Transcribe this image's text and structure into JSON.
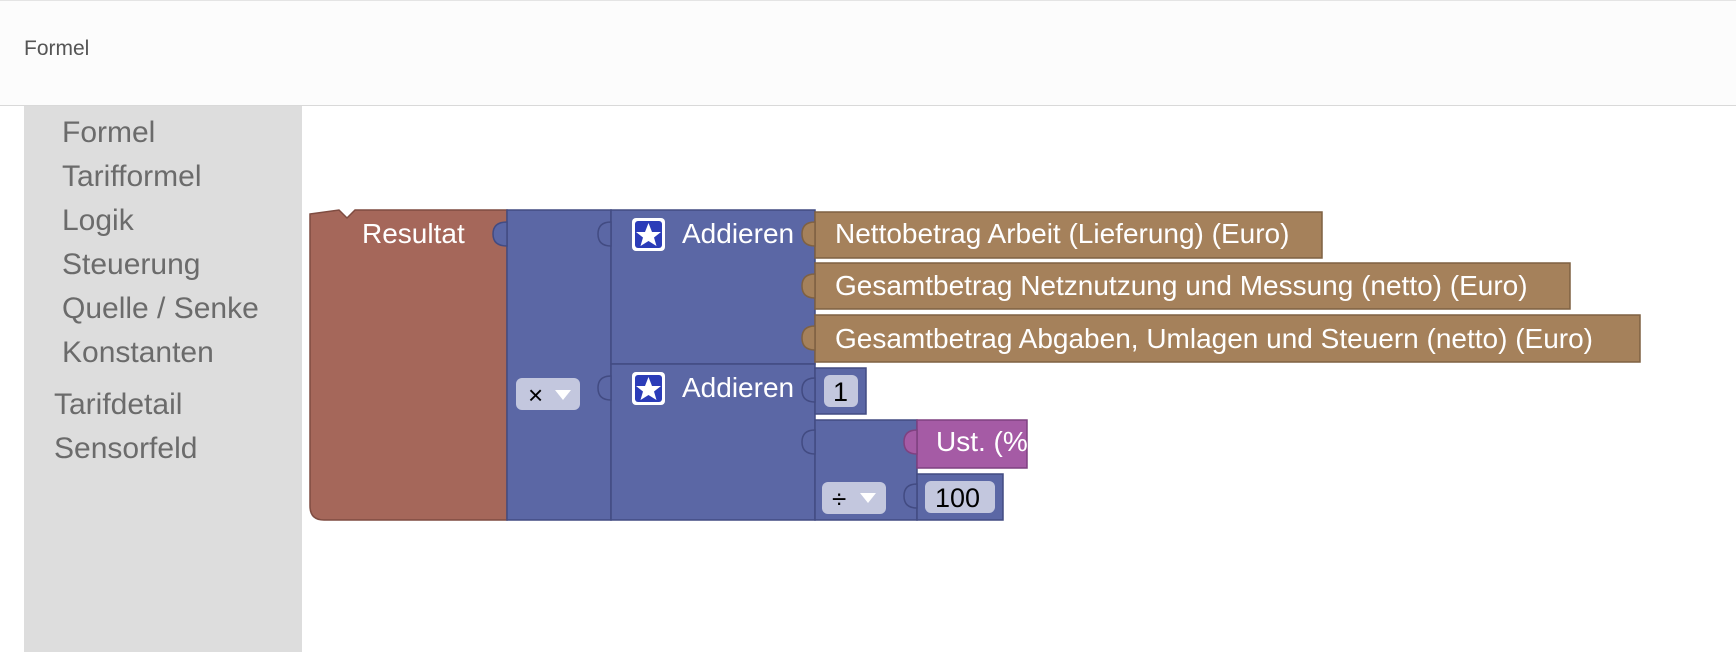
{
  "header": {
    "title": "Formel"
  },
  "toolbox": {
    "categories": [
      {
        "label": "Formel"
      },
      {
        "label": "Tarifformel"
      },
      {
        "label": "Logik"
      },
      {
        "label": "Steuerung"
      },
      {
        "label": "Quelle / Senke"
      },
      {
        "label": "Konstanten"
      }
    ],
    "top_categories": [
      {
        "label": "Tarifdetail"
      },
      {
        "label": "Sensorfeld"
      }
    ]
  },
  "blocks": {
    "result": {
      "label": "Resultat",
      "color": "#a5675a"
    },
    "arith_outer": {
      "operator": "×",
      "color": "#5b67a5"
    },
    "add_top": {
      "label": "Addieren",
      "icon": "star-icon",
      "color": "#5b67a5"
    },
    "add_bottom": {
      "label": "Addieren",
      "icon": "star-icon",
      "color": "#5b67a5"
    },
    "field_1": {
      "label": "Nettobetrag Arbeit (Lieferung) (Euro)",
      "color": "#a5815b"
    },
    "field_2": {
      "label": "Gesamtbetrag Netznutzung und Messung (netto) (Euro)",
      "color": "#a5815b"
    },
    "field_3": {
      "label": "Gesamtbetrag Abgaben, Umlagen und Steuern (netto) (Euro)",
      "color": "#a5815b"
    },
    "number_1": {
      "value": "1"
    },
    "arith_inner": {
      "operator": "÷"
    },
    "vat": {
      "label": "Ust. (%)",
      "color": "#a55ba5"
    },
    "number_100": {
      "value": "100"
    }
  }
}
